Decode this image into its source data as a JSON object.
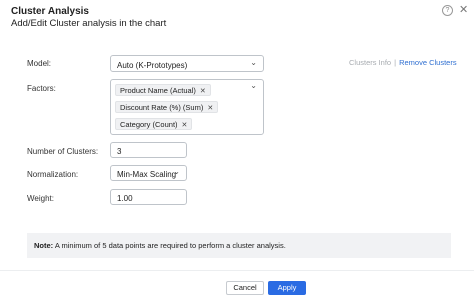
{
  "dialog": {
    "title": "Cluster Analysis",
    "subtitle": "Add/Edit Cluster analysis in the chart",
    "help_glyph": "?",
    "close_glyph": "✕"
  },
  "links": {
    "clusters_info": "Clusters Info",
    "separator": "|",
    "remove_clusters": "Remove Clusters"
  },
  "model": {
    "label": "Model:",
    "value": "Auto (K-Prototypes)"
  },
  "factors": {
    "label": "Factors:",
    "chips": [
      {
        "label": "Product Name (Actual)"
      },
      {
        "label": "Discount Rate (%) (Sum)"
      },
      {
        "label": "Category (Count)"
      }
    ]
  },
  "num_clusters": {
    "label": "Number of Clusters:",
    "value": "3"
  },
  "normalization": {
    "label": "Normalization:",
    "value": "Min-Max Scaling"
  },
  "weight": {
    "label": "Weight:",
    "value": "1.00"
  },
  "note": {
    "prefix": "Note:",
    "text": " A minimum of 5 data points are required to perform a cluster analysis."
  },
  "buttons": {
    "cancel": "Cancel",
    "apply": "Apply"
  },
  "colors": {
    "accent": "#2a6be3",
    "link": "#2f6fd1",
    "muted_link": "#a7abb0",
    "note_bg": "#f1f2f4"
  },
  "icons": {
    "help": "help-icon",
    "close": "close-icon",
    "dropdown": "chevron-down-icon",
    "chip_remove": "close-icon"
  }
}
